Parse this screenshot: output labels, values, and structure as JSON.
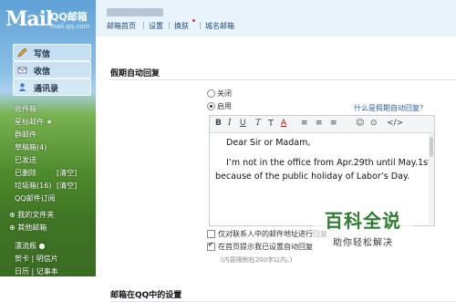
{
  "logo": {
    "main": "Mail",
    "qq": "QQ邮箱",
    "domain": "mail.qq.com"
  },
  "sidebar": {
    "buttons": [
      {
        "label": "写信",
        "icon": "pencil-icon"
      },
      {
        "label": "收信",
        "icon": "inbox-icon"
      },
      {
        "label": "通讯录",
        "icon": "contacts-icon"
      }
    ],
    "folders": [
      {
        "label": "收件箱"
      },
      {
        "label": "星标邮件 ★"
      },
      {
        "label": "群邮件"
      },
      {
        "label": "草稿箱(4)"
      },
      {
        "label": "已发送"
      },
      {
        "label": "已删除",
        "action": "[清空]"
      },
      {
        "label": "垃圾箱(16)",
        "action": "[清空]"
      },
      {
        "label": "QQ邮件订阅"
      },
      {
        "label": "⊕ 我的文件夹"
      },
      {
        "label": "⊕ 其他邮箱"
      },
      {
        "label": "漂流瓶 ●"
      },
      {
        "label": "贺卡 | 明信片"
      },
      {
        "label": "日历 | 记事本"
      }
    ]
  },
  "topbar": {
    "nav": [
      "邮箱首页",
      "设置",
      "换肤",
      "城名邮箱"
    ],
    "separators": [
      "|",
      "|",
      "|"
    ]
  },
  "content": {
    "section1_title": "假期自动回复",
    "radio_off": "关闭",
    "radio_on": "启用",
    "help_link": "什么是假期自动回复？",
    "toolbar": [
      "B",
      "I",
      "U",
      "T",
      "T",
      "A",
      "≡",
      "≡",
      "≡",
      "☺",
      "⊙",
      "</>"
    ],
    "editor_lines": [
      "Dear Sir or Madam,",
      "I’m not in the office from Apr.29th until May.1st",
      "because of the public holiday of Labor’s Day."
    ],
    "check1": "仅对联系人中的邮件地址进行回复",
    "check2": "在首页提示我已设置自动回复",
    "limit_note": "(内容限制在200字以内。)",
    "section2_title": "邮箱在QQ中的设置"
  },
  "watermark": {
    "title": "百科全说",
    "subtitle": "助你轻松解决"
  },
  "colors": {
    "accent": "#2a5ea8",
    "watermark": "#2f7d32"
  }
}
